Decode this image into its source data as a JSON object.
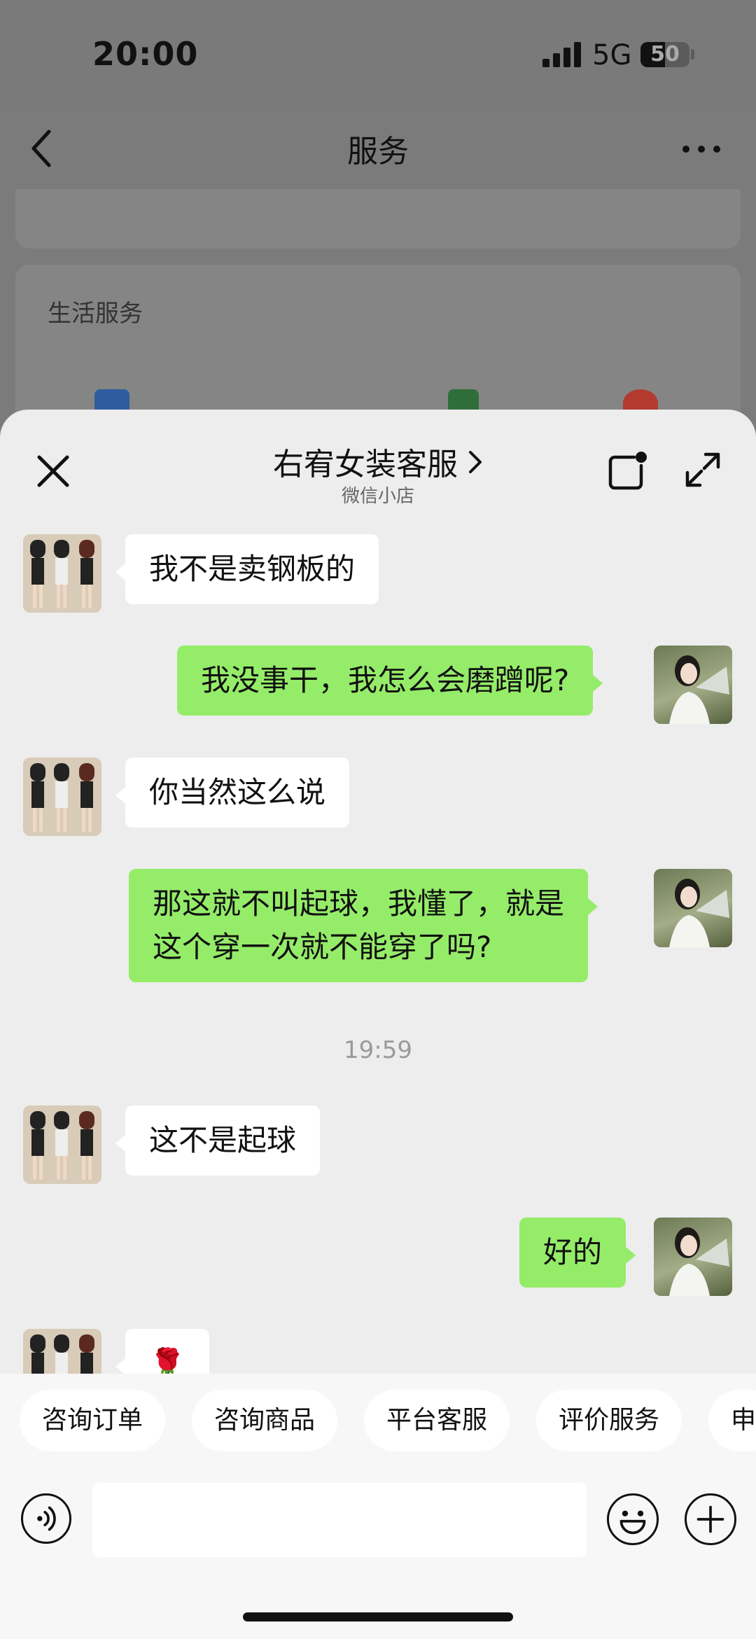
{
  "status_bar": {
    "time": "20:00",
    "network": "5G",
    "battery": "50",
    "battery_level": 0.5
  },
  "nav": {
    "title": "服务"
  },
  "background": {
    "section_label": "生活服务"
  },
  "chat": {
    "title": "右宥女装客服",
    "subtitle": "微信小店",
    "messages": [
      {
        "side": "in",
        "text": "我不是卖钢板的"
      },
      {
        "side": "out",
        "text": "我没事干，我怎么会磨蹭呢?"
      },
      {
        "side": "in",
        "text": "你当然这么说"
      },
      {
        "side": "out",
        "text": "那这就不叫起球，我懂了，就是\n这个穿一次就不能穿了吗?"
      },
      {
        "side": "time",
        "text": "19:59"
      },
      {
        "side": "in",
        "text": "这不是起球"
      },
      {
        "side": "out",
        "text": "好的"
      },
      {
        "side": "in",
        "text": "🌹"
      }
    ]
  },
  "quick_replies": [
    "咨询订单",
    "咨询商品",
    "平台客服",
    "评价服务",
    "申"
  ],
  "colors": {
    "incoming_bubble": "#ffffff",
    "outgoing_bubble": "#95ec69",
    "sheet_bg": "#ededed"
  }
}
